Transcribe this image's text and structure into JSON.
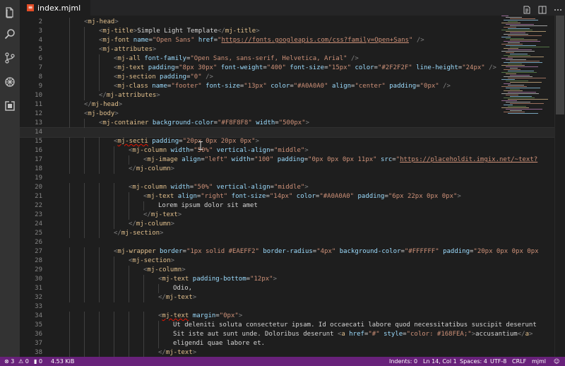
{
  "tab": {
    "filename": "index.mjml"
  },
  "editor": {
    "lines": [
      {
        "num": "2",
        "tokens": [
          [
            "p",
            "<"
          ],
          [
            "t",
            "mj-head"
          ],
          [
            "p",
            ">"
          ]
        ],
        "indent": 1
      },
      {
        "num": "3",
        "tokens": [
          [
            "p",
            "<"
          ],
          [
            "t",
            "mj-title"
          ],
          [
            "p",
            ">"
          ],
          [
            "x",
            "Simple Light Template"
          ],
          [
            "p",
            "</"
          ],
          [
            "t",
            "mj-title"
          ],
          [
            "p",
            ">"
          ]
        ],
        "indent": 2
      },
      {
        "num": "4",
        "tokens": [
          [
            "p",
            "<"
          ],
          [
            "t",
            "mj-font"
          ],
          [
            "x",
            " "
          ],
          [
            "a",
            "name"
          ],
          [
            "x",
            "="
          ],
          [
            "s",
            "\"Open Sans\""
          ],
          [
            "x",
            " "
          ],
          [
            "a",
            "href"
          ],
          [
            "x",
            "="
          ],
          [
            "s",
            "\""
          ],
          [
            "u",
            "https://fonts.googleapis.com/css?family=Open+Sans"
          ],
          [
            "s",
            "\""
          ],
          [
            "x",
            " "
          ],
          [
            "p",
            "/>"
          ]
        ],
        "indent": 2
      },
      {
        "num": "5",
        "tokens": [
          [
            "p",
            "<"
          ],
          [
            "t",
            "mj-attributes"
          ],
          [
            "p",
            ">"
          ]
        ],
        "indent": 2
      },
      {
        "num": "6",
        "tokens": [
          [
            "p",
            "<"
          ],
          [
            "t",
            "mj-all"
          ],
          [
            "x",
            " "
          ],
          [
            "a",
            "font-family"
          ],
          [
            "x",
            "="
          ],
          [
            "s",
            "\"Open Sans, sans-serif, Helvetica, Arial\""
          ],
          [
            "x",
            " "
          ],
          [
            "p",
            "/>"
          ]
        ],
        "indent": 3
      },
      {
        "num": "7",
        "tokens": [
          [
            "p",
            "<"
          ],
          [
            "t",
            "mj-text"
          ],
          [
            "x",
            " "
          ],
          [
            "a",
            "padding"
          ],
          [
            "x",
            "="
          ],
          [
            "s",
            "\"8px 30px\""
          ],
          [
            "x",
            " "
          ],
          [
            "a",
            "font-weight"
          ],
          [
            "x",
            "="
          ],
          [
            "s",
            "\"400\""
          ],
          [
            "x",
            " "
          ],
          [
            "a",
            "font-size"
          ],
          [
            "x",
            "="
          ],
          [
            "s",
            "\"15px\""
          ],
          [
            "x",
            " "
          ],
          [
            "a",
            "color"
          ],
          [
            "x",
            "="
          ],
          [
            "s",
            "\"#2F2F2F\""
          ],
          [
            "x",
            " "
          ],
          [
            "a",
            "line-height"
          ],
          [
            "x",
            "="
          ],
          [
            "s",
            "\"24px\""
          ],
          [
            "x",
            " "
          ],
          [
            "p",
            "/>"
          ]
        ],
        "indent": 3
      },
      {
        "num": "8",
        "tokens": [
          [
            "p",
            "<"
          ],
          [
            "t",
            "mj-section"
          ],
          [
            "x",
            " "
          ],
          [
            "a",
            "padding"
          ],
          [
            "x",
            "="
          ],
          [
            "s",
            "\"0\""
          ],
          [
            "x",
            " "
          ],
          [
            "p",
            "/>"
          ]
        ],
        "indent": 3
      },
      {
        "num": "9",
        "tokens": [
          [
            "p",
            "<"
          ],
          [
            "t",
            "mj-class"
          ],
          [
            "x",
            " "
          ],
          [
            "a",
            "name"
          ],
          [
            "x",
            "="
          ],
          [
            "s",
            "\"footer\""
          ],
          [
            "x",
            " "
          ],
          [
            "a",
            "font-size"
          ],
          [
            "x",
            "="
          ],
          [
            "s",
            "\"13px\""
          ],
          [
            "x",
            " "
          ],
          [
            "a",
            "color"
          ],
          [
            "x",
            "="
          ],
          [
            "s",
            "\"#A0A0A0\""
          ],
          [
            "x",
            " "
          ],
          [
            "a",
            "align"
          ],
          [
            "x",
            "="
          ],
          [
            "s",
            "\"center\""
          ],
          [
            "x",
            " "
          ],
          [
            "a",
            "padding"
          ],
          [
            "x",
            "="
          ],
          [
            "s",
            "\"0px\""
          ],
          [
            "x",
            " "
          ],
          [
            "p",
            "/>"
          ]
        ],
        "indent": 3
      },
      {
        "num": "10",
        "tokens": [
          [
            "p",
            "</"
          ],
          [
            "t",
            "mj-attributes"
          ],
          [
            "p",
            ">"
          ]
        ],
        "indent": 2
      },
      {
        "num": "11",
        "tokens": [
          [
            "p",
            "</"
          ],
          [
            "t",
            "mj-head"
          ],
          [
            "p",
            ">"
          ]
        ],
        "indent": 1
      },
      {
        "num": "12",
        "tokens": [
          [
            "p",
            "<"
          ],
          [
            "t",
            "mj-body"
          ],
          [
            "p",
            ">"
          ]
        ],
        "indent": 1
      },
      {
        "num": "13",
        "tokens": [
          [
            "p",
            "<"
          ],
          [
            "t",
            "mj-container"
          ],
          [
            "x",
            " "
          ],
          [
            "a",
            "background-color"
          ],
          [
            "x",
            "="
          ],
          [
            "s",
            "\"#F8F8F8\""
          ],
          [
            "x",
            " "
          ],
          [
            "a",
            "width"
          ],
          [
            "x",
            "="
          ],
          [
            "s",
            "\"500px\""
          ],
          [
            "p",
            ">"
          ]
        ],
        "indent": 2
      },
      {
        "num": "14",
        "tokens": [],
        "indent": 0,
        "current": true
      },
      {
        "num": "15",
        "tokens": [
          [
            "p",
            "<"
          ],
          [
            "e",
            "mj-secti"
          ],
          [
            "x",
            " "
          ],
          [
            "a",
            "padding"
          ],
          [
            "x",
            "="
          ],
          [
            "s",
            "\"20px 0px 20px 0px\""
          ],
          [
            "p",
            ">"
          ]
        ],
        "indent": 3
      },
      {
        "num": "16",
        "tokens": [
          [
            "p",
            "<"
          ],
          [
            "t",
            "mj-column"
          ],
          [
            "x",
            " "
          ],
          [
            "a",
            "width"
          ],
          [
            "x",
            "="
          ],
          [
            "s",
            "\"50%\""
          ],
          [
            "x",
            " "
          ],
          [
            "a",
            "vertical-align"
          ],
          [
            "x",
            "="
          ],
          [
            "s",
            "\"middle\""
          ],
          [
            "p",
            ">"
          ]
        ],
        "indent": 4
      },
      {
        "num": "17",
        "tokens": [
          [
            "p",
            "<"
          ],
          [
            "t",
            "mj-image"
          ],
          [
            "x",
            " "
          ],
          [
            "a",
            "align"
          ],
          [
            "x",
            "="
          ],
          [
            "s",
            "\"left\""
          ],
          [
            "x",
            " "
          ],
          [
            "a",
            "width"
          ],
          [
            "x",
            "="
          ],
          [
            "s",
            "\"100\""
          ],
          [
            "x",
            " "
          ],
          [
            "a",
            "padding"
          ],
          [
            "x",
            "="
          ],
          [
            "s",
            "\"0px 0px 0px 11px\""
          ],
          [
            "x",
            " "
          ],
          [
            "a",
            "src"
          ],
          [
            "x",
            "="
          ],
          [
            "s",
            "\""
          ],
          [
            "u",
            "https://placeholdit.imgix.net/~text?"
          ]
        ],
        "indent": 5
      },
      {
        "num": "18",
        "tokens": [
          [
            "p",
            "</"
          ],
          [
            "t",
            "mj-column"
          ],
          [
            "p",
            ">"
          ]
        ],
        "indent": 4
      },
      {
        "num": "19",
        "tokens": [],
        "indent": 0
      },
      {
        "num": "20",
        "tokens": [
          [
            "p",
            "<"
          ],
          [
            "t",
            "mj-column"
          ],
          [
            "x",
            " "
          ],
          [
            "a",
            "width"
          ],
          [
            "x",
            "="
          ],
          [
            "s",
            "\"50%\""
          ],
          [
            "x",
            " "
          ],
          [
            "a",
            "vertical-align"
          ],
          [
            "x",
            "="
          ],
          [
            "s",
            "\"middle\""
          ],
          [
            "p",
            ">"
          ]
        ],
        "indent": 4
      },
      {
        "num": "21",
        "tokens": [
          [
            "p",
            "<"
          ],
          [
            "t",
            "mj-text"
          ],
          [
            "x",
            " "
          ],
          [
            "a",
            "align"
          ],
          [
            "x",
            "="
          ],
          [
            "s",
            "\"right\""
          ],
          [
            "x",
            " "
          ],
          [
            "a",
            "font-size"
          ],
          [
            "x",
            "="
          ],
          [
            "s",
            "\"14px\""
          ],
          [
            "x",
            " "
          ],
          [
            "a",
            "color"
          ],
          [
            "x",
            "="
          ],
          [
            "s",
            "\"#A0A0A0\""
          ],
          [
            "x",
            " "
          ],
          [
            "a",
            "padding"
          ],
          [
            "x",
            "="
          ],
          [
            "s",
            "\"6px 22px 0px 0px\""
          ],
          [
            "p",
            ">"
          ]
        ],
        "indent": 5
      },
      {
        "num": "22",
        "tokens": [
          [
            "x",
            "Lorem ipsum dolor sit amet"
          ]
        ],
        "indent": 6
      },
      {
        "num": "23",
        "tokens": [
          [
            "p",
            "</"
          ],
          [
            "t",
            "mj-text"
          ],
          [
            "p",
            ">"
          ]
        ],
        "indent": 5
      },
      {
        "num": "24",
        "tokens": [
          [
            "p",
            "</"
          ],
          [
            "t",
            "mj-column"
          ],
          [
            "p",
            ">"
          ]
        ],
        "indent": 4
      },
      {
        "num": "25",
        "tokens": [
          [
            "p",
            "</"
          ],
          [
            "t",
            "mj-section"
          ],
          [
            "p",
            ">"
          ]
        ],
        "indent": 3
      },
      {
        "num": "26",
        "tokens": [],
        "indent": 0
      },
      {
        "num": "27",
        "tokens": [
          [
            "p",
            "<"
          ],
          [
            "t",
            "mj-wrapper"
          ],
          [
            "x",
            " "
          ],
          [
            "a",
            "border"
          ],
          [
            "x",
            "="
          ],
          [
            "s",
            "\"1px solid #EAEFF2\""
          ],
          [
            "x",
            " "
          ],
          [
            "a",
            "border-radius"
          ],
          [
            "x",
            "="
          ],
          [
            "s",
            "\"4px\""
          ],
          [
            "x",
            " "
          ],
          [
            "a",
            "background-color"
          ],
          [
            "x",
            "="
          ],
          [
            "s",
            "\"#FFFFFF\""
          ],
          [
            "x",
            " "
          ],
          [
            "a",
            "padding"
          ],
          [
            "x",
            "="
          ],
          [
            "s",
            "\"20px 0px 0px 0px"
          ]
        ],
        "indent": 3
      },
      {
        "num": "28",
        "tokens": [
          [
            "p",
            "<"
          ],
          [
            "t",
            "mj-section"
          ],
          [
            "p",
            ">"
          ]
        ],
        "indent": 4
      },
      {
        "num": "29",
        "tokens": [
          [
            "p",
            "<"
          ],
          [
            "t",
            "mj-column"
          ],
          [
            "p",
            ">"
          ]
        ],
        "indent": 5
      },
      {
        "num": "30",
        "tokens": [
          [
            "p",
            "<"
          ],
          [
            "t",
            "mj-text"
          ],
          [
            "x",
            " "
          ],
          [
            "a",
            "padding-bottom"
          ],
          [
            "x",
            "="
          ],
          [
            "s",
            "\"12px\""
          ],
          [
            "p",
            ">"
          ]
        ],
        "indent": 6
      },
      {
        "num": "31",
        "tokens": [
          [
            "x",
            "Odio,"
          ]
        ],
        "indent": 7
      },
      {
        "num": "32",
        "tokens": [
          [
            "p",
            "</"
          ],
          [
            "t",
            "mj-text"
          ],
          [
            "p",
            ">"
          ]
        ],
        "indent": 6
      },
      {
        "num": "33",
        "tokens": [],
        "indent": 0
      },
      {
        "num": "34",
        "tokens": [
          [
            "p",
            "<"
          ],
          [
            "e",
            "mj-text"
          ],
          [
            "x",
            " "
          ],
          [
            "a",
            "margin"
          ],
          [
            "x",
            "="
          ],
          [
            "s",
            "\"0px\""
          ],
          [
            "p",
            ">"
          ]
        ],
        "indent": 6
      },
      {
        "num": "35",
        "tokens": [
          [
            "x",
            "Ut deleniti soluta consectetur ipsam. Id occaecati labore quod necessitatibus suscipit deserunt"
          ]
        ],
        "indent": 7
      },
      {
        "num": "36",
        "tokens": [
          [
            "x",
            "Sit iste aut sunt unde. Doloribus deserunt "
          ],
          [
            "p",
            "<"
          ],
          [
            "t",
            "a"
          ],
          [
            "x",
            " "
          ],
          [
            "a",
            "href"
          ],
          [
            "x",
            "="
          ],
          [
            "s",
            "\"#\""
          ],
          [
            "x",
            " "
          ],
          [
            "a",
            "style"
          ],
          [
            "x",
            "="
          ],
          [
            "s",
            "\"color: #168FEA;\""
          ],
          [
            "p",
            ">"
          ],
          [
            "x",
            "accusantium"
          ],
          [
            "p",
            "</"
          ],
          [
            "t",
            "a"
          ],
          [
            "p",
            ">"
          ]
        ],
        "indent": 7
      },
      {
        "num": "37",
        "tokens": [
          [
            "x",
            "eligendi quae labore et."
          ]
        ],
        "indent": 7
      },
      {
        "num": "38",
        "tokens": [
          [
            "p",
            "</"
          ],
          [
            "t",
            "mj-text"
          ],
          [
            "p",
            ">"
          ]
        ],
        "indent": 6
      }
    ]
  },
  "status": {
    "errors": "3",
    "warnings": "0",
    "mentions": "0",
    "size": "4.53 KiB",
    "indents": "Indents: 0",
    "position": "Ln 14, Col 1",
    "spaces": "Spaces: 4",
    "encoding": "UTF-8",
    "eol": "CRLF",
    "language": "mjml"
  },
  "colors": {
    "statusbar": "#68217a",
    "activitybar": "#333333",
    "editor_bg": "#1e1e1e"
  }
}
